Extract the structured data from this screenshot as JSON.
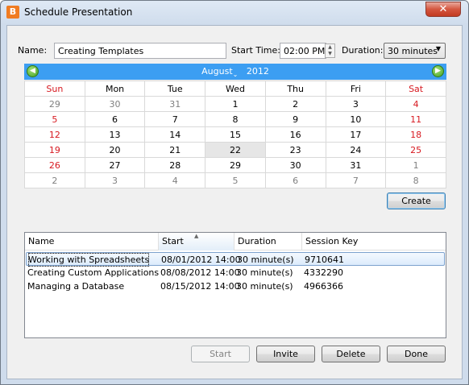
{
  "window": {
    "title": "Schedule Presentation",
    "app_icon_letter": "B",
    "close_symbol": "✕"
  },
  "form": {
    "name_label": "Name:",
    "name_value": "Creating Templates",
    "start_time_label": "Start Time:",
    "start_time_value": "02:00 PM",
    "duration_label": "Duration:",
    "duration_value": "30 minutes"
  },
  "calendar": {
    "month": "August",
    "year": "2012",
    "weekdays": [
      "Sun",
      "Mon",
      "Tue",
      "Wed",
      "Thu",
      "Fri",
      "Sat"
    ],
    "weeks": [
      [
        "29",
        "30",
        "31",
        "1",
        "2",
        "3",
        "4"
      ],
      [
        "5",
        "6",
        "7",
        "8",
        "9",
        "10",
        "11"
      ],
      [
        "12",
        "13",
        "14",
        "15",
        "16",
        "17",
        "18"
      ],
      [
        "19",
        "20",
        "21",
        "22",
        "23",
        "24",
        "25"
      ],
      [
        "26",
        "27",
        "28",
        "29",
        "30",
        "31",
        "1"
      ],
      [
        "2",
        "3",
        "4",
        "5",
        "6",
        "7",
        "8"
      ]
    ],
    "selected_day": "22",
    "weekend_color": "#d71920",
    "header_color": "#3c9ef2"
  },
  "create_button": "Create",
  "sessions": {
    "columns": [
      "Name",
      "Start",
      "Duration",
      "Session Key"
    ],
    "sort_column": "Start",
    "rows": [
      {
        "name": "Working with Spreadsheets",
        "start": "08/01/2012 14:00",
        "duration": "30 minute(s)",
        "key": "9710641"
      },
      {
        "name": "Creating Custom Applications",
        "start": "08/08/2012 14:00",
        "duration": "30 minute(s)",
        "key": "4332290"
      },
      {
        "name": "Managing a Database",
        "start": "08/15/2012 14:00",
        "duration": "30 minute(s)",
        "key": "4966366"
      }
    ]
  },
  "buttons": {
    "start": "Start",
    "invite": "Invite",
    "delete": "Delete",
    "done": "Done"
  }
}
